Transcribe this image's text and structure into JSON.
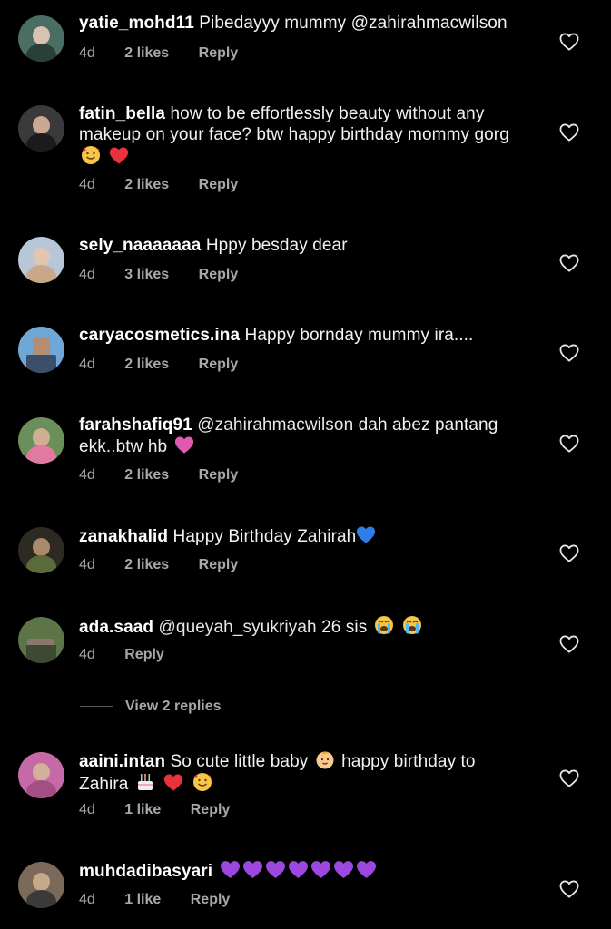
{
  "colors": {
    "background": "#000000",
    "text": "#f2f2f2",
    "meta": "#a8a8a8",
    "heart_outline": "#e6e6e6",
    "emoji_red": "#e8323c",
    "emoji_purple": "#9b47e0",
    "emoji_blue": "#2f7ee8",
    "emoji_pink": "#e05bb0",
    "emoji_yellow": "#f6c646"
  },
  "comments": [
    {
      "username": "yatie_mohd11",
      "text": "Pibedayyy mummy @zahirahmacwilson",
      "time": "4d",
      "likes": "2 likes",
      "reply": "Reply",
      "avatar_colors": [
        "#4a6e63",
        "#d8c2b0",
        "#2a3f3a"
      ]
    },
    {
      "username": "fatin_bella",
      "text": "how to be effortlessly beauty without any makeup on your face? btw happy birthday mommy gorg",
      "emojis": [
        "smiling-face-with-hearts-emoji",
        "red-heart-emoji"
      ],
      "time": "4d",
      "likes": "2 likes",
      "reply": "Reply",
      "avatar_colors": [
        "#3a3a3a",
        "#caa894",
        "#1b1b1b"
      ]
    },
    {
      "username": "sely_naaaaaaa",
      "text": "Hppy besday dear",
      "time": "4d",
      "likes": "3 likes",
      "reply": "Reply",
      "avatar_colors": [
        "#b8c7d8",
        "#e2c6b0",
        "#c9a88a"
      ]
    },
    {
      "username": "caryacosmetics.ina",
      "text": "Happy bornday mummy ira....",
      "time": "4d",
      "likes": "2 likes",
      "reply": "Reply",
      "avatar_colors": [
        "#6fa7d6",
        "#3b4f6a",
        "#b58d73"
      ]
    },
    {
      "username": "farahshafiq91",
      "mention": "@zahirahmacwilson",
      "text": "dah abez pantang ekk..btw hb",
      "emojis": [
        "growing-heart-emoji"
      ],
      "time": "4d",
      "likes": "2 likes",
      "reply": "Reply",
      "avatar_colors": [
        "#6b8f5a",
        "#cfae92",
        "#e07aa0"
      ]
    },
    {
      "username": "zanakhalid",
      "text": "Happy Birthday Zahirah",
      "emojis": [
        "blue-heart-emoji"
      ],
      "time": "4d",
      "likes": "2 likes",
      "reply": "Reply",
      "avatar_colors": [
        "#2c2a22",
        "#a98a6c",
        "#5b6a3a"
      ]
    },
    {
      "username": "ada.saad",
      "mention": "@queyah_syukriyah",
      "text": "26 sis",
      "emojis": [
        "loudly-crying-face-emoji",
        "loudly-crying-face-emoji"
      ],
      "time": "4d",
      "reply": "Reply",
      "avatar_colors": [
        "#5d7448",
        "#8c7868",
        "#3c4a34"
      ]
    },
    {
      "username": "aaini.intan",
      "text": "So cute little baby",
      "text2": "happy birthday to Zahira",
      "emojis": [
        "baby-emoji"
      ],
      "emojis2": [
        "birthday-cake-emoji",
        "red-heart-emoji",
        "smiling-face-with-hearts-emoji"
      ],
      "time": "4d",
      "likes": "1 like",
      "reply": "Reply",
      "avatar_colors": [
        "#c56aa6",
        "#d4b09a",
        "#a54e84"
      ]
    },
    {
      "username": "muhdadibasyari",
      "emoji_count": 7,
      "emoji_name": "purple-heart-emoji",
      "time": "4d",
      "likes": "1 like",
      "reply": "Reply",
      "avatar_colors": [
        "#7b6a5a",
        "#c8a88a",
        "#3a3a3a"
      ]
    }
  ],
  "view_replies": "View 2 replies"
}
